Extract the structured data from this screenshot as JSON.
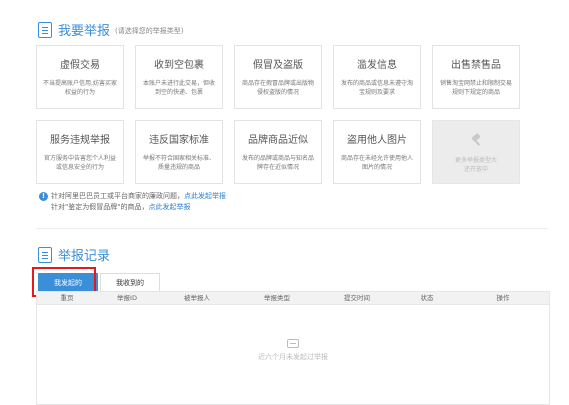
{
  "report_section": {
    "title": "我要举报",
    "hint": "(请选择您的举报类型)"
  },
  "report_types": [
    {
      "title": "虚假交易",
      "desc": "不当提高账户信用,妨害买家权益的行为"
    },
    {
      "title": "收到空包裹",
      "desc": "本账户未进行此交易，但收到空的快递、包裹"
    },
    {
      "title": "假冒及盗版",
      "desc": "商品存在假冒品牌或出版物侵权盗版的情况"
    },
    {
      "title": "滥发信息",
      "desc": "发布的商品或信息未遵守淘宝规则及要求"
    },
    {
      "title": "出售禁售品",
      "desc": "销售淘宝网禁止和限制交易规则下规定的商品"
    },
    {
      "title": "服务违规举报",
      "desc": "官方服务中告害您个人利益或信息安全的行为"
    },
    {
      "title": "违反国家标准",
      "desc": "举报不符合国家相关标准、质量违规的商品"
    },
    {
      "title": "品牌商品近似",
      "desc": "发布的品牌或商品与知名品牌存在近似情况"
    },
    {
      "title": "盗用他人图片",
      "desc": "商品存在未经允许使用他人图片的情况"
    }
  ],
  "more_types": {
    "desc": "更多举报类型大\n还开放中"
  },
  "notice": {
    "line1_prefix": "针对阿里巴巴员工或平台商家的廉政问题，",
    "line1_link": "点此发起举报",
    "line2_prefix": "针对\"鉴定为假冒品牌\"的商品，",
    "line2_link": "点此发起举报"
  },
  "records_section": {
    "title": "举报记录"
  },
  "tabs": [
    {
      "label": "我发起的",
      "active": true
    },
    {
      "label": "我收到的",
      "active": false
    }
  ],
  "table": {
    "columns": [
      "重页",
      "举报ID",
      "被举报人",
      "举报类型",
      "提交时间",
      "状态",
      "操作"
    ],
    "empty_text": "近六个月未发起过举报"
  },
  "colors": {
    "accent": "#3a8fd8",
    "highlight": "#e2191f"
  }
}
